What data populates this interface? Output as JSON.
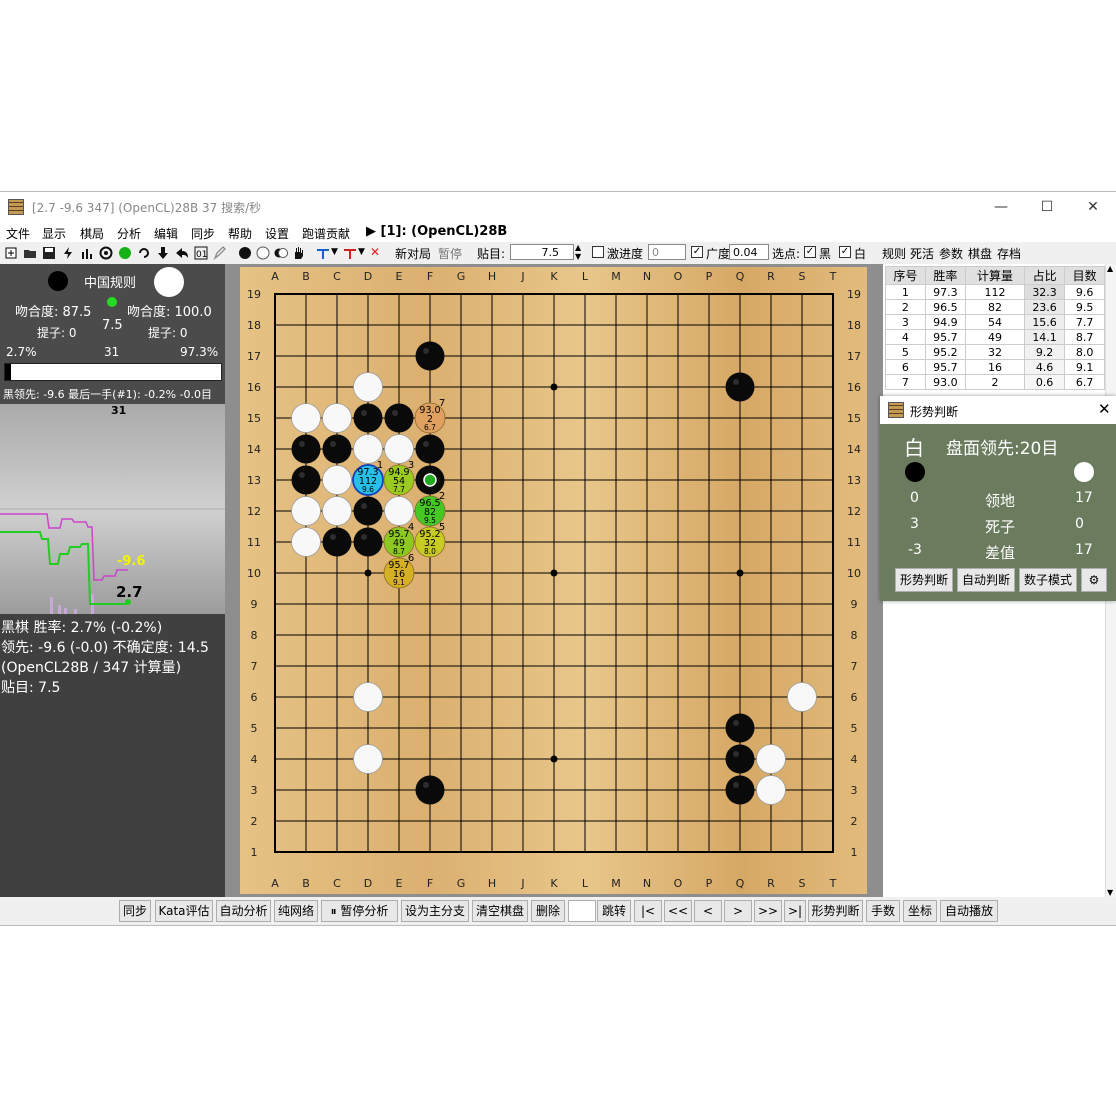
{
  "window": {
    "title": "[2.7 -9.6 347] (OpenCL)28B 37 搜索/秒",
    "minimize": "—",
    "maximize": "☐",
    "close": "✕"
  },
  "menu": {
    "items": [
      "文件",
      "显示",
      "棋局",
      "分析",
      "编辑",
      "同步",
      "帮助",
      "设置",
      "跑谱贡献"
    ],
    "engine_label": "▶ [1]: (OpenCL)28B"
  },
  "toolbar": {
    "new_game": "新对局",
    "pause": "暂停",
    "komi_label": "贴目:",
    "komi_value": "7.5",
    "aggression_label": "激进度",
    "aggression_value": "0",
    "breadth_label": "广度",
    "breadth_value": "0.04",
    "pick_label": "选点:",
    "black_label": "黑",
    "white_label": "白",
    "rules": "规则",
    "life_death": "死活",
    "params": "参数",
    "board": "棋盘",
    "save": "存档"
  },
  "left_panel": {
    "ruleset": "中国规则",
    "black_match": "吻合度: 87.5",
    "white_match": "吻合度: 100.0",
    "komi": "7.5",
    "black_captures": "提子: 0",
    "white_captures": "提子: 0",
    "black_pct": "2.7%",
    "move_count": "31",
    "white_pct": "97.3%",
    "status_line": "黑领先: -9.6 最后一手(#1): -0.2% -0.0目",
    "chart_move_label": "31",
    "chart_score_label": "-9.6",
    "chart_winrate_label": "2.7",
    "info_line1": "黑棋 胜率: 2.7% (-0.2%)",
    "info_line2": "领先: -9.6 (-0.0) 不确定度: 14.5",
    "info_line3": "(OpenCL28B / 347 计算量)",
    "info_line4": "贴目: 7.5"
  },
  "board": {
    "col_labels": [
      "A",
      "B",
      "C",
      "D",
      "E",
      "F",
      "G",
      "H",
      "J",
      "K",
      "L",
      "M",
      "N",
      "O",
      "P",
      "Q",
      "R",
      "S",
      "T"
    ],
    "row_labels": [
      "19",
      "18",
      "17",
      "16",
      "15",
      "14",
      "13",
      "12",
      "11",
      "10",
      "9",
      "8",
      "7",
      "6",
      "5",
      "4",
      "3",
      "2",
      "1"
    ],
    "black_stones": [
      "F17",
      "Q16",
      "D15",
      "E15",
      "B14",
      "C14",
      "F14",
      "B13",
      "D12",
      "C11",
      "D11",
      "Q5",
      "Q4",
      "F3",
      "Q3"
    ],
    "white_stones": [
      "D16",
      "B15",
      "C15",
      "D14",
      "E14",
      "C13",
      "B12",
      "C12",
      "E12",
      "B11",
      "S6",
      "D6",
      "D4",
      "R4",
      "R3"
    ],
    "last_move": "F13",
    "star_points": [
      "D16",
      "K16",
      "Q16",
      "D10",
      "K10",
      "Q10",
      "D4",
      "K4",
      "Q4"
    ],
    "candidates": [
      {
        "point": "D13",
        "rank": "1",
        "winrate": "97.3",
        "visits": "112",
        "score": "9.6",
        "color": "#29c0e8"
      },
      {
        "point": "F12",
        "rank": "2",
        "winrate": "96.5",
        "visits": "82",
        "score": "9.5",
        "color": "#46c824"
      },
      {
        "point": "E13",
        "rank": "3",
        "winrate": "94.9",
        "visits": "54",
        "score": "7.7",
        "color": "#9acb1e"
      },
      {
        "point": "E11",
        "rank": "4",
        "winrate": "95.7",
        "visits": "49",
        "score": "8.7",
        "color": "#8cc820"
      },
      {
        "point": "F11",
        "rank": "5",
        "winrate": "95.2",
        "visits": "32",
        "score": "8.0",
        "color": "#c8cc22"
      },
      {
        "point": "E10",
        "rank": "6",
        "winrate": "95.7",
        "visits": "16",
        "score": "9.1",
        "color": "#d4b022"
      },
      {
        "point": "F15",
        "rank": "7",
        "winrate": "93.0",
        "visits": "2",
        "score": "6.7",
        "color": "#e0a060"
      }
    ]
  },
  "analysis_table": {
    "headers": [
      "序号",
      "胜率",
      "计算量",
      "占比",
      "目数"
    ],
    "rows": [
      [
        "1",
        "97.3",
        "112",
        "32.3",
        "9.6"
      ],
      [
        "2",
        "96.5",
        "82",
        "23.6",
        "9.5"
      ],
      [
        "3",
        "94.9",
        "54",
        "15.6",
        "7.7"
      ],
      [
        "4",
        "95.7",
        "49",
        "14.1",
        "8.7"
      ],
      [
        "5",
        "95.2",
        "32",
        "9.2",
        "8.0"
      ],
      [
        "6",
        "95.7",
        "16",
        "4.6",
        "9.1"
      ],
      [
        "7",
        "93.0",
        "2",
        "0.6",
        "6.7"
      ]
    ]
  },
  "situation_dialog": {
    "title": "形势判断",
    "leader": "白",
    "lead_text": "盘面领先:20目",
    "rows": [
      {
        "label": "领地",
        "black": "0",
        "white": "17"
      },
      {
        "label": "死子",
        "black": "3",
        "white": "0"
      },
      {
        "label": "差值",
        "black": "-3",
        "white": "17"
      }
    ],
    "btn_judge": "形势判断",
    "btn_auto": "自动判断",
    "btn_digit": "数子模式"
  },
  "bottom_bar": {
    "buttons": [
      "同步",
      "Kata评估",
      "自动分析",
      "纯网络",
      "⏸ 暂停分析",
      "设为主分支",
      "清空棋盘",
      "删除",
      "",
      "跳转",
      "|<",
      "<<",
      "<",
      ">",
      ">>",
      ">|",
      "形势判断",
      "手数",
      "坐标",
      "自动播放"
    ]
  }
}
